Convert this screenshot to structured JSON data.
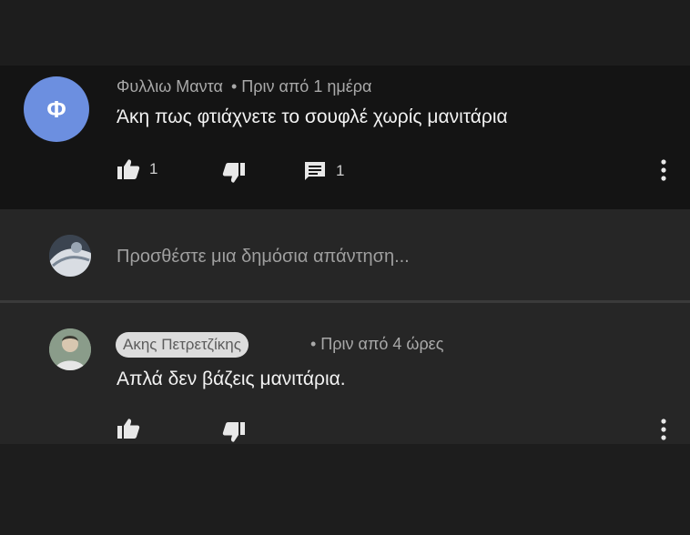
{
  "comment": {
    "author": "Φυλλιω Μαντα",
    "time": "• Πριν από 1 ημέρα",
    "avatar_letter": "Φ",
    "avatar_color": "#6c8fe0",
    "text": "Άκη πως φτιάχνετε το σουφλέ χωρίς μανιτάρια",
    "like_count": "1",
    "reply_count": "1"
  },
  "reply_box": {
    "placeholder": "Προσθέστε μια δημόσια απάντηση..."
  },
  "reply": {
    "author": "Ακης Πετρετζίκης",
    "time": "• Πριν από 4 ώρες",
    "text": "Απλά δεν βάζεις μανιτάρια."
  },
  "icons": {
    "like": "thumbs-up-icon",
    "dislike": "thumbs-down-icon",
    "replies": "comment-icon",
    "menu": "more-vertical-icon"
  }
}
